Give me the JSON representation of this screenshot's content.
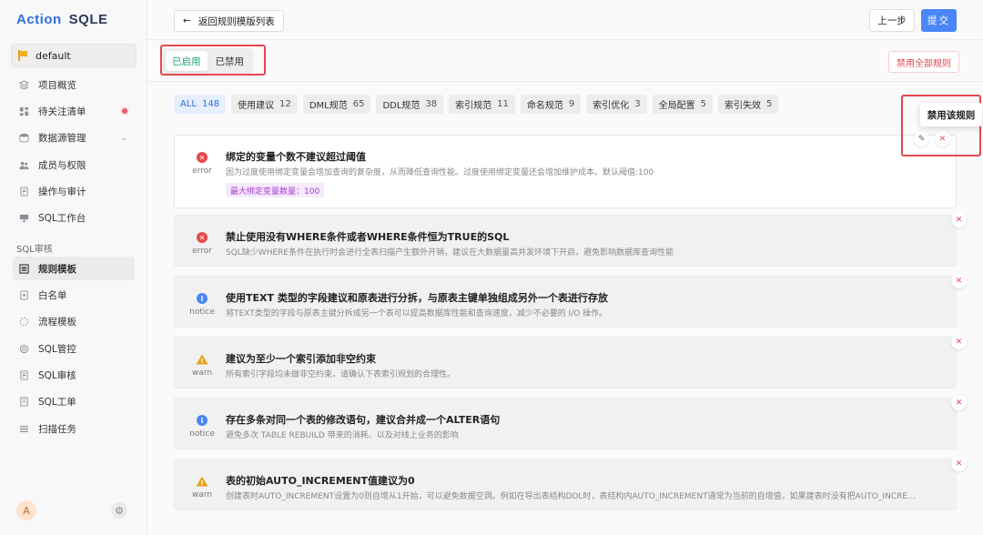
{
  "app": {
    "brand": "Action",
    "product": "SQLE"
  },
  "project": {
    "name": "default"
  },
  "nav": [
    {
      "label": "项目概览",
      "icon": "layers-icon"
    },
    {
      "label": "待关注清单",
      "icon": "dashboard-icon",
      "dot": true
    },
    {
      "label": "数据源管理",
      "icon": "database-icon",
      "chevron": true
    },
    {
      "label": "成员与权限",
      "icon": "users-icon"
    },
    {
      "label": "操作与审计",
      "icon": "audit-icon"
    },
    {
      "label": "SQL工作台",
      "icon": "monitor-icon"
    }
  ],
  "section_label": "SQL审核",
  "nav2": [
    {
      "label": "规则模板",
      "icon": "template-icon",
      "active": true
    },
    {
      "label": "白名单",
      "icon": "whitelist-icon"
    },
    {
      "label": "流程模板",
      "icon": "flow-icon"
    },
    {
      "label": "SQL管控",
      "icon": "control-icon"
    },
    {
      "label": "SQL审核",
      "icon": "audit-icon"
    },
    {
      "label": "SQL工单",
      "icon": "ticket-icon"
    },
    {
      "label": "扫描任务",
      "icon": "scan-icon"
    }
  ],
  "user": {
    "avatar": "A"
  },
  "topbar": {
    "back_label": "返回规则模版列表",
    "prev_label": "上一步",
    "submit_label": "提交"
  },
  "status_tabs": [
    {
      "label": "已启用",
      "active": true
    },
    {
      "label": "已禁用",
      "active": false
    }
  ],
  "disable_all_label": "禁用全部规则",
  "filters": [
    {
      "label": "ALL",
      "count": "148",
      "active": true
    },
    {
      "label": "使用建议",
      "count": "12"
    },
    {
      "label": "DML规范",
      "count": "65"
    },
    {
      "label": "DDL规范",
      "count": "38"
    },
    {
      "label": "索引规范",
      "count": "11"
    },
    {
      "label": "命名规范",
      "count": "9"
    },
    {
      "label": "索引优化",
      "count": "3"
    },
    {
      "label": "全局配置",
      "count": "5"
    },
    {
      "label": "索引失效",
      "count": "5"
    }
  ],
  "tooltip": "禁用该规则",
  "rules": [
    {
      "level": "error",
      "title": "绑定的变量个数不建议超过阈值",
      "desc": "因为过度使用绑定变量会增加查询的复杂度，从而降低查询性能。过度使用绑定变量还会增加维护成本。默认阈值:100",
      "param": "最大绑定变量数量：100"
    },
    {
      "level": "error",
      "title": "禁止使用没有WHERE条件或者WHERE条件恒为TRUE的SQL",
      "desc": "SQL缺少WHERE条件在执行时会进行全表扫描产生额外开销，建议在大数据量高并发环境下开启，避免影响数据库查询性能"
    },
    {
      "level": "notice",
      "title": "使用TEXT 类型的字段建议和原表进行分拆，与原表主键单独组成另外一个表进行存放",
      "desc": "将TEXT类型的字段与原表主键分拆成另一个表可以提高数据库性能和查询速度，减少不必要的 I/O 操作。"
    },
    {
      "level": "warn",
      "title": "建议为至少一个索引添加非空约束",
      "desc": "所有索引字段均未做非空约束，请确认下表索引规划的合理性。"
    },
    {
      "level": "notice",
      "title": "存在多条对同一个表的修改语句，建议合并成一个ALTER语句",
      "desc": "避免多次 TABLE REBUILD 带来的消耗、以及对线上业务的影响"
    },
    {
      "level": "warn",
      "title": "表的初始AUTO_INCREMENT值建议为0",
      "desc": "创建表时AUTO_INCREMENT设置为0则自增从1开始，可以避免数据空洞。例如在导出表结构DDL时，表结构内AUTO_INCREMENT通常为当前的自增值，如果建表时没有把AUTO_INCREMENT设置为0..."
    }
  ],
  "colors": {
    "primary": "#4a86f7",
    "success": "#1aa56a",
    "danger": "#e5484d",
    "brand": "#2f6fe0"
  }
}
